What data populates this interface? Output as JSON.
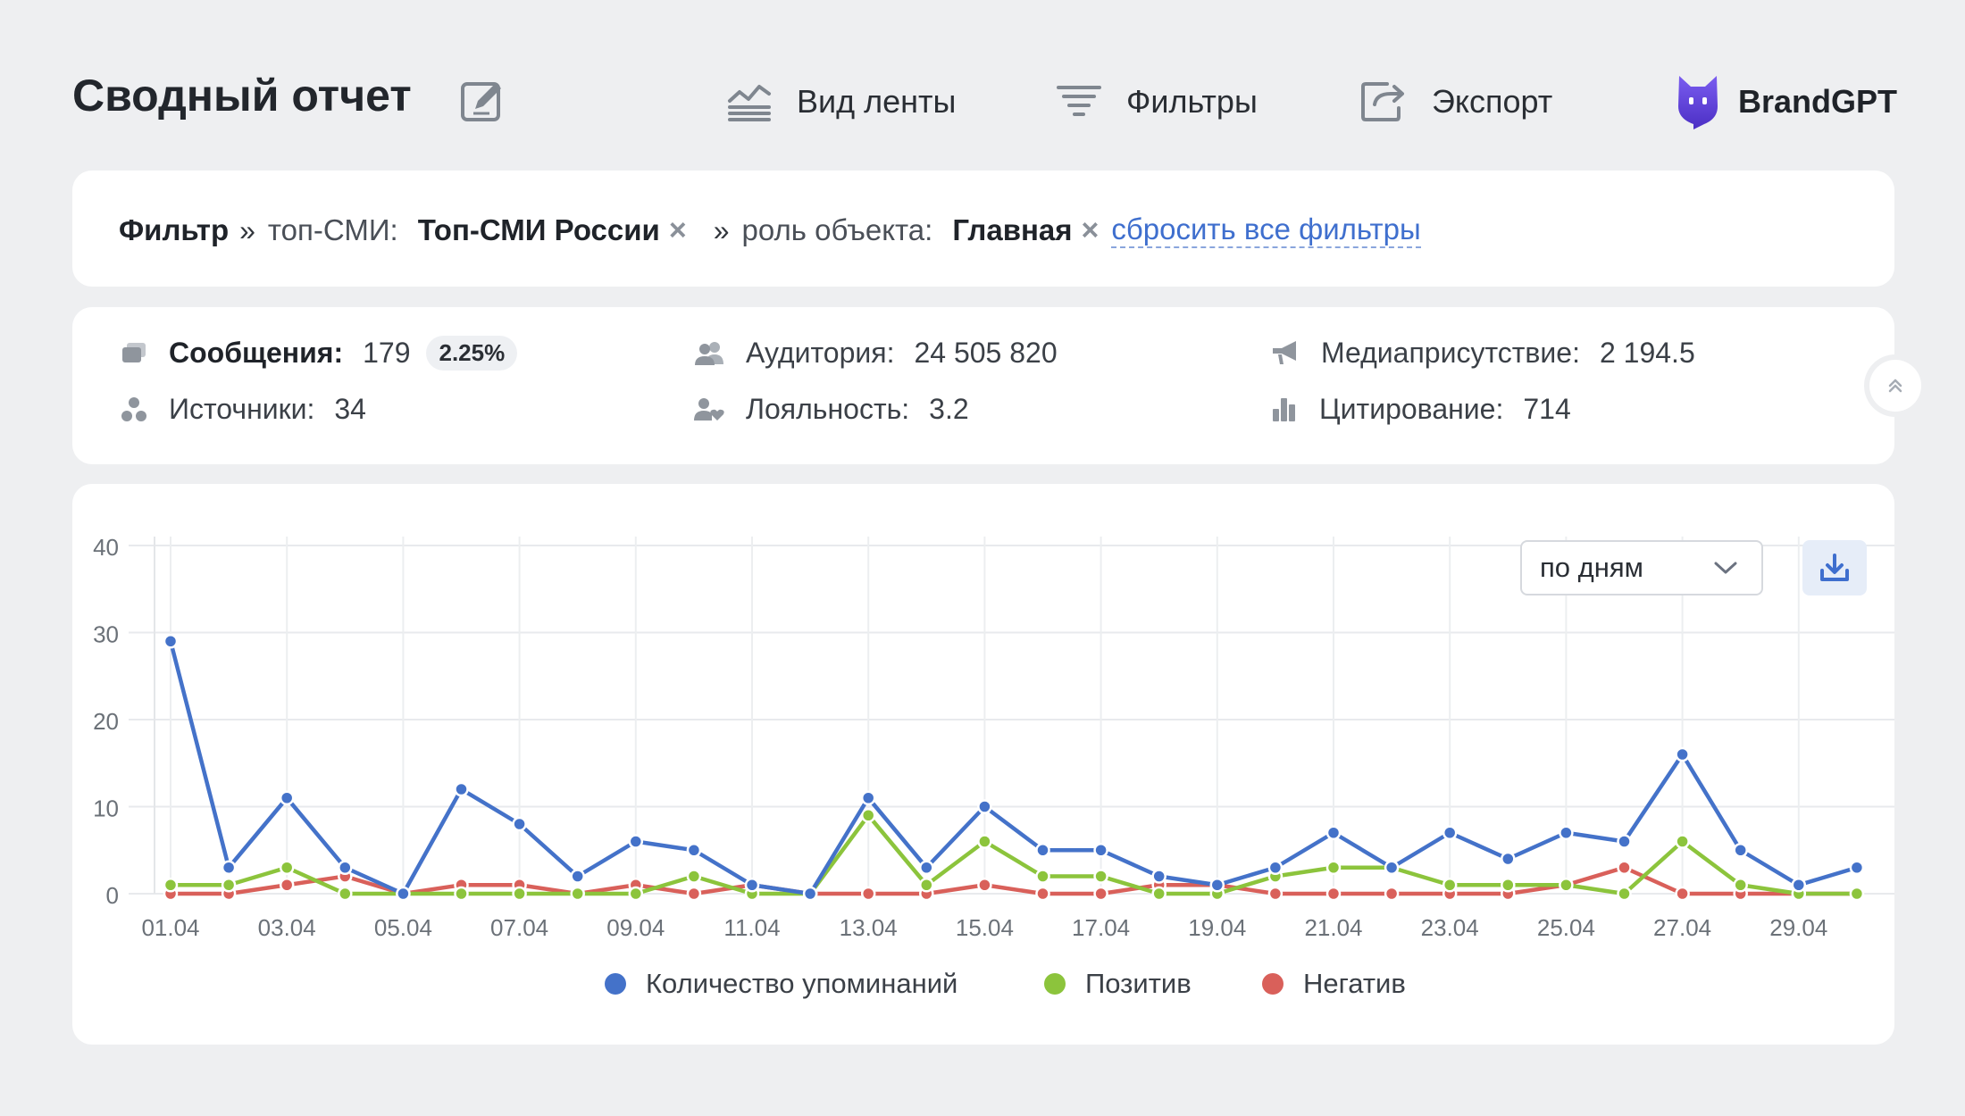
{
  "header": {
    "title": "Сводный отчет",
    "feed_view": "Вид ленты",
    "filters": "Фильтры",
    "export": "Экспорт",
    "brand": "BrandGPT"
  },
  "filter_bar": {
    "label": "Фильтр",
    "sep": "»",
    "filter1_name": "топ-СМИ:",
    "filter1_value": "Топ-СМИ России",
    "filter2_name": "роль объекта:",
    "filter2_value": "Главная",
    "remove_glyph": "×",
    "reset_all": "сбросить все фильтры"
  },
  "stats": {
    "messages_label": "Сообщения:",
    "messages_value": "179",
    "messages_pct": "2.25%",
    "sources_label": "Источники:",
    "sources_value": "34",
    "audience_label": "Аудитория:",
    "audience_value": "24 505 820",
    "loyalty_label": "Лояльность:",
    "loyalty_value": "3.2",
    "media_label": "Медиаприсутствие:",
    "media_value": "2 194.5",
    "citation_label": "Цитирование:",
    "citation_value": "714"
  },
  "controls": {
    "period_select": "по дням"
  },
  "colors": {
    "mentions": "#4472c9",
    "positive": "#8cc43c",
    "negative": "#d9605a",
    "link": "#3f6fce"
  },
  "chart_data": {
    "type": "line",
    "x": [
      "01.04",
      "02.04",
      "03.04",
      "04.04",
      "05.04",
      "06.04",
      "07.04",
      "08.04",
      "09.04",
      "10.04",
      "11.04",
      "12.04",
      "13.04",
      "14.04",
      "15.04",
      "16.04",
      "17.04",
      "18.04",
      "19.04",
      "20.04",
      "21.04",
      "22.04",
      "23.04",
      "24.04",
      "25.04",
      "26.04",
      "27.04",
      "28.04",
      "29.04",
      "30.04"
    ],
    "x_tick_labels": [
      "01.04",
      "03.04",
      "05.04",
      "07.04",
      "09.04",
      "11.04",
      "13.04",
      "15.04",
      "17.04",
      "19.04",
      "21.04",
      "23.04",
      "25.04",
      "27.04",
      "29.04"
    ],
    "y_ticks": [
      "0",
      "10",
      "20",
      "30",
      "40"
    ],
    "ylim": [
      0,
      40
    ],
    "grid": true,
    "legend_position": "bottom",
    "series": [
      {
        "name": "Количество упоминаний",
        "values": [
          29,
          3,
          11,
          3,
          0,
          12,
          8,
          2,
          6,
          5,
          1,
          0,
          11,
          3,
          10,
          5,
          5,
          2,
          1,
          3,
          7,
          3,
          7,
          4,
          7,
          6,
          16,
          5,
          1,
          3
        ]
      },
      {
        "name": "Позитив",
        "values": [
          1,
          1,
          3,
          0,
          0,
          0,
          0,
          0,
          0,
          2,
          0,
          0,
          9,
          1,
          6,
          2,
          2,
          0,
          0,
          2,
          3,
          3,
          1,
          1,
          1,
          0,
          6,
          1,
          0,
          0
        ]
      },
      {
        "name": "Негатив",
        "values": [
          0,
          0,
          1,
          2,
          0,
          1,
          1,
          0,
          1,
          0,
          1,
          0,
          0,
          0,
          1,
          0,
          0,
          1,
          1,
          0,
          0,
          0,
          0,
          0,
          1,
          3,
          0,
          0,
          0,
          0
        ]
      }
    ]
  }
}
